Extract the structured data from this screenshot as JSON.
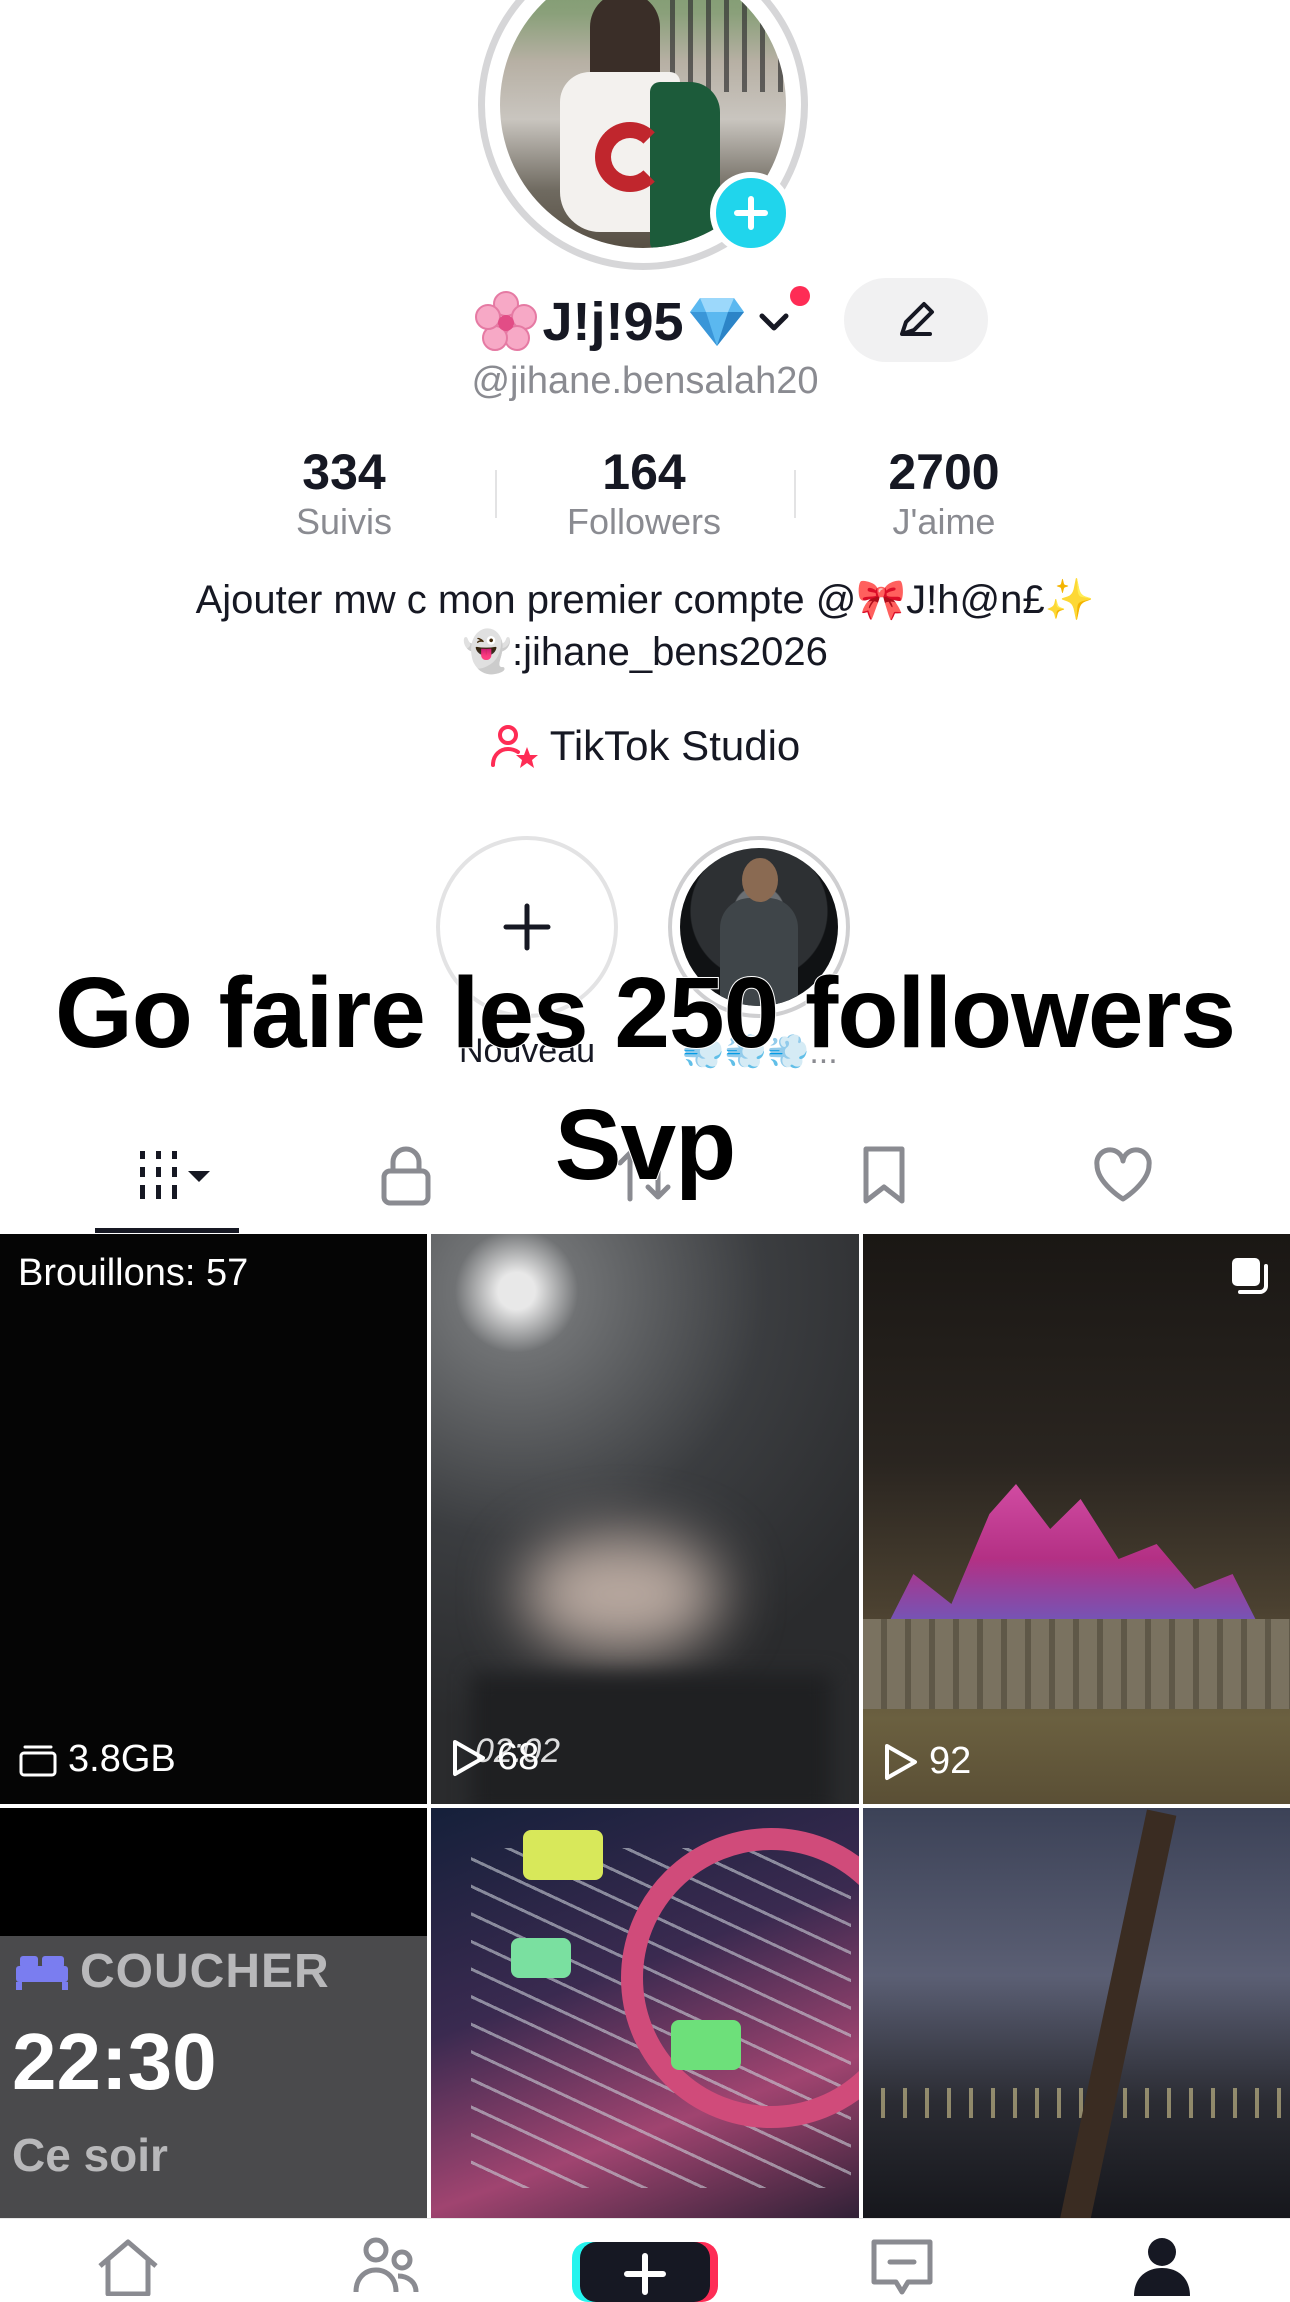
{
  "profile": {
    "display_name": "J!j!95",
    "username": "@jihane.bensalah20",
    "bio_line_1": "Ajouter mw c mon premier compte @🎀J!h@n£✨",
    "bio_line_2": "👻:jihane_bens2026",
    "studio_label": "TikTok Studio"
  },
  "stats": [
    {
      "value": "334",
      "label": "Suivis"
    },
    {
      "value": "164",
      "label": "Followers"
    },
    {
      "value": "2700",
      "label": "J'aime"
    }
  ],
  "highlights": {
    "new_label": "Nouveau",
    "story_label": "💨💨💨..."
  },
  "overlay": {
    "line_1": "Go faire les 250 followers",
    "line_2": "Svp"
  },
  "grid": {
    "drafts_label": "Brouillons: 57",
    "drafts_size": "3.8GB",
    "video_2_views": "68",
    "video_2_timestamp": "02:02",
    "video_3_views": "92",
    "alarm_label": "COUCHER",
    "alarm_time": "22:30",
    "alarm_sub": "Ce soir"
  },
  "colors": {
    "accent_pink": "#fe2c55",
    "accent_cyan": "#20d5ec",
    "text_primary": "#161823",
    "text_secondary": "#8a8b91"
  },
  "icons": {
    "avatar_add": "plus-icon",
    "name_dropdown": "chevron-down-icon",
    "edit": "pencil-icon",
    "studio": "user-star-icon",
    "tabs": [
      "grid-icon",
      "lock-icon",
      "repost-icon",
      "bookmark-icon",
      "heart-icon"
    ],
    "bottom_nav": [
      "home-icon",
      "friends-icon",
      "create-icon",
      "inbox-icon",
      "profile-icon"
    ]
  }
}
